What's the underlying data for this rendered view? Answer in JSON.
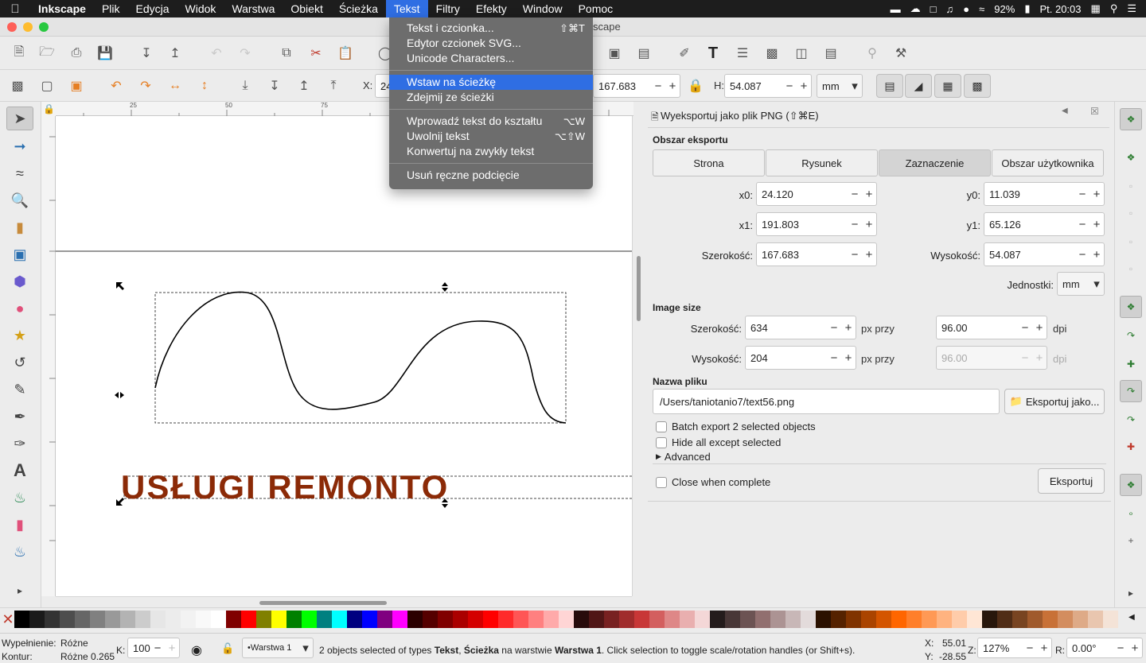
{
  "menubar": {
    "app": "Inkscape",
    "items": [
      "Plik",
      "Edycja",
      "Widok",
      "Warstwa",
      "Obiekt",
      "Ścieżka",
      "Tekst",
      "Filtry",
      "Efekty",
      "Window",
      "Pomoc"
    ],
    "battery": "92%",
    "clock": "Pt. 20:03"
  },
  "window": {
    "title_fragment": "scape"
  },
  "text_menu": {
    "items": [
      {
        "label": "Tekst i czcionka...",
        "shortcut": "⇧⌘T"
      },
      {
        "label": "Edytor czcionek SVG...",
        "shortcut": ""
      },
      {
        "label": "Unicode Characters...",
        "shortcut": ""
      },
      {
        "label": "Wstaw na ścieżkę",
        "shortcut": ""
      },
      {
        "label": "Zdejmij ze ścieżki",
        "shortcut": ""
      },
      {
        "label": "Wprowadź tekst do kształtu",
        "shortcut": "⌥W"
      },
      {
        "label": "Uwolnij tekst",
        "shortcut": "⌥⇧W"
      },
      {
        "label": "Konwertuj na zwykły tekst",
        "shortcut": ""
      },
      {
        "label": "Usuń ręczne podcięcie",
        "shortcut": ""
      }
    ]
  },
  "controls": {
    "x_label": "X:",
    "x_value": "24.",
    "w_value": "167.683",
    "h_label": "H:",
    "h_value": "54.087",
    "unit": "mm"
  },
  "canvas": {
    "text": "USŁUGI REMONTO",
    "text_color": "#8b2a07",
    "ruler_marks": [
      "25",
      "50",
      "75"
    ]
  },
  "export": {
    "title": "Wyeksportuj jako plik PNG (⇧⌘E)",
    "area_heading": "Obszar eksportu",
    "area_tabs": [
      "Strona",
      "Rysunek",
      "Zaznaczenie",
      "Obszar użytkownika"
    ],
    "x0_label": "x0:",
    "x0": "24.120",
    "y0_label": "y0:",
    "y0": "11.039",
    "x1_label": "x1:",
    "x1": "191.803",
    "y1_label": "y1:",
    "y1": "65.126",
    "width_label": "Szerokość:",
    "width": "167.683",
    "height_label": "Wysokość:",
    "height": "54.087",
    "units_label": "Jednostki:",
    "units": "mm",
    "image_size_heading": "Image size",
    "img_width_label": "Szerokość:",
    "img_width": "634",
    "img_height_label": "Wysokość:",
    "img_height": "204",
    "px_at": "px przy",
    "dpi_x": "96.00",
    "dpi_y": "96.00",
    "dpi": "dpi",
    "filename_heading": "Nazwa pliku",
    "filename": "/Users/taniotanio7/text56.png",
    "export_as": "Eksportuj jako...",
    "batch": "Batch export 2 selected objects",
    "hide_all": "Hide all except selected",
    "advanced": "Advanced",
    "close_when": "Close when complete",
    "export_btn": "Eksportuj"
  },
  "status": {
    "fill_label": "Wypełnienie:",
    "fill_value": "Różne",
    "stroke_label": "Kontur:",
    "stroke_value": "Różne 0.265",
    "k_label": "K:",
    "k_value": "100",
    "layer": "•Warstwa 1",
    "message_pre": "2 objects selected of types ",
    "m_b1": "Tekst",
    "m_c1": ", ",
    "m_b2": "Ścieżka",
    "m_c2": " na warstwie ",
    "m_b3": "Warstwa 1",
    "message_post": ". Click selection to toggle scale/rotation handles (or Shift+s).",
    "x_label": "X:",
    "x": "55.01",
    "y_label": "Y:",
    "y": "-28.55",
    "z_label": "Z:",
    "zoom": "127%",
    "r_label": "R:",
    "rotation": "0.00°"
  },
  "palette": [
    "#000000",
    "#1a1a1a",
    "#333333",
    "#4d4d4d",
    "#666666",
    "#808080",
    "#999999",
    "#b3b3b3",
    "#cccccc",
    "#e6e6e6",
    "#ececec",
    "#f2f2f2",
    "#f9f9f9",
    "#ffffff",
    "#800000",
    "#ff0000",
    "#808000",
    "#ffff00",
    "#008000",
    "#00ff00",
    "#008080",
    "#00ffff",
    "#000080",
    "#0000ff",
    "#800080",
    "#ff00ff",
    "#2b0000",
    "#550000",
    "#800000",
    "#aa0000",
    "#d40000",
    "#ff0000",
    "#ff2a2a",
    "#ff5555",
    "#ff8080",
    "#ffaaaa",
    "#ffd5d5",
    "#280b0b",
    "#501616",
    "#782121",
    "#a02c2c",
    "#c83737",
    "#d35f5f",
    "#de8787",
    "#e9afaf",
    "#f4d7d7",
    "#241c1c",
    "#483737",
    "#6c5353",
    "#916f6f",
    "#ac9393",
    "#c8b7b7",
    "#e3dbdb",
    "#2b1100",
    "#552200",
    "#803300",
    "#aa4400",
    "#d45500",
    "#ff6600",
    "#ff7f2a",
    "#ff9955",
    "#ffb380",
    "#ffccaa",
    "#ffe6d5",
    "#28170b",
    "#502d16",
    "#784421",
    "#a05a2c",
    "#c87137",
    "#d38d5f",
    "#deaa87",
    "#e9c6af",
    "#f4e3d7"
  ]
}
